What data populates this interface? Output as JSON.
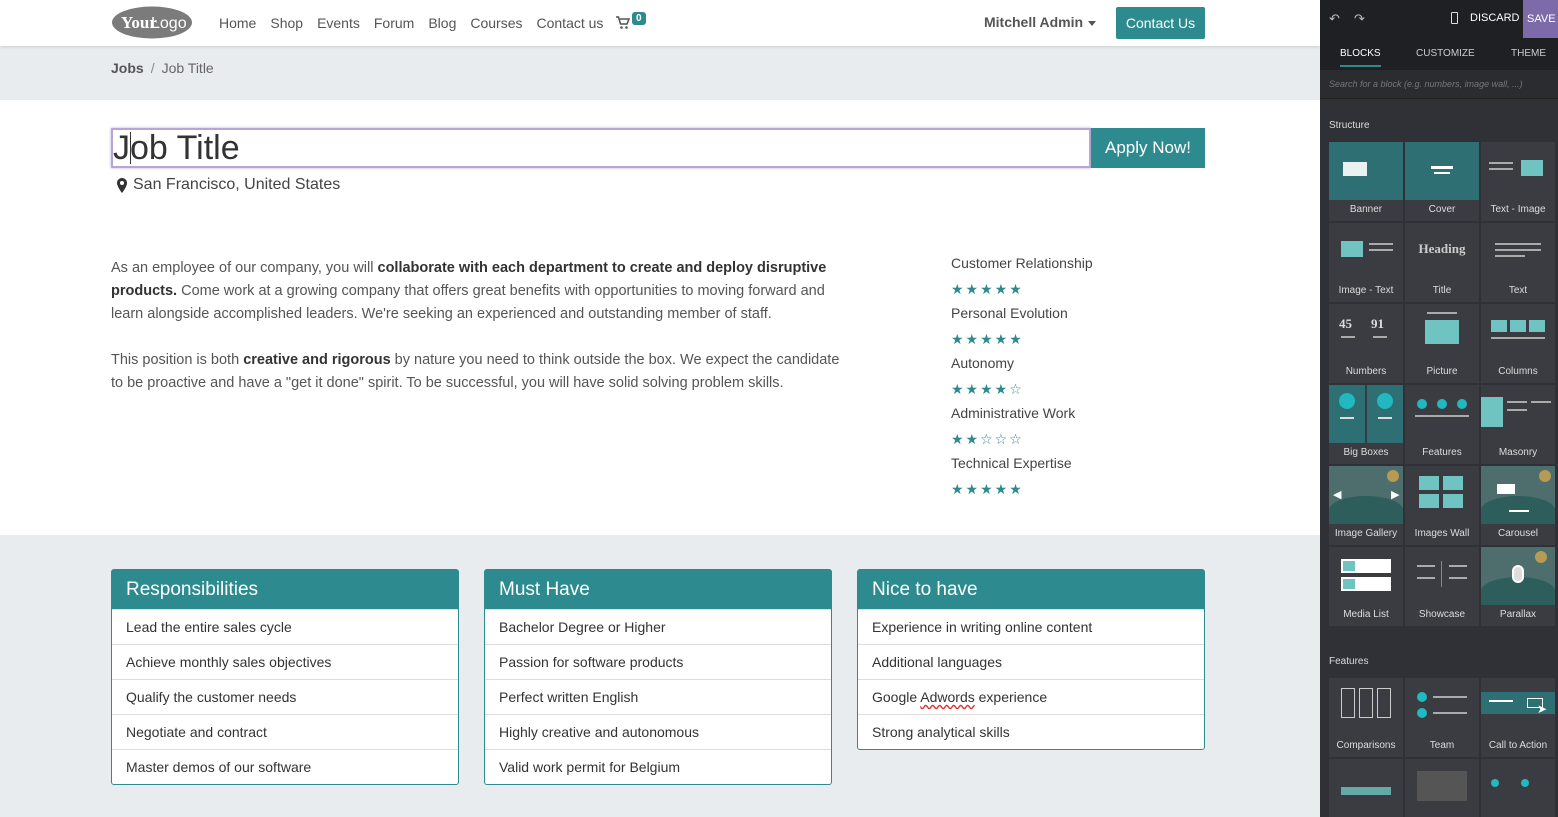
{
  "nav": {
    "logo_text_1": "Your",
    "logo_text_2": "Logo",
    "links": [
      "Home",
      "Shop",
      "Events",
      "Forum",
      "Blog",
      "Courses",
      "Contact us"
    ],
    "cart_count": "0",
    "user": "Mitchell Admin",
    "contact_button": "Contact Us"
  },
  "breadcrumb": {
    "parent": "Jobs",
    "separator": "/",
    "current": "Job Title"
  },
  "job": {
    "title": "Job Title",
    "apply_button": "Apply Now!",
    "location": "San Francisco, United States"
  },
  "description": {
    "p1_a": "As an employee of our company, you will ",
    "p1_b": "collaborate with each department to create and deploy disruptive products.",
    "p1_c": " Come work at a growing company that offers great benefits with opportunities to moving forward and learn alongside accomplished leaders. We're seeking an experienced and outstanding member of staff.",
    "p2_a": "This position is both ",
    "p2_b": "creative and rigorous",
    "p2_c": " by nature you need to think outside the box. We expect the candidate to be proactive and have a \"get it done\" spirit. To be successful, you will have solid solving problem skills."
  },
  "skills": [
    {
      "name": "Customer Relationship",
      "stars": "★★★★★",
      "rating": 5
    },
    {
      "name": "Personal Evolution",
      "stars": "★★★★★",
      "rating": 5
    },
    {
      "name": "Autonomy",
      "stars": "★★★★☆",
      "rating": 4
    },
    {
      "name": "Administrative Work",
      "stars": "★★☆☆☆",
      "rating": 2
    },
    {
      "name": "Technical Expertise",
      "stars": "★★★★★",
      "rating": 5
    }
  ],
  "panels": [
    {
      "title": "Responsibilities",
      "items": [
        "Lead the entire sales cycle",
        "Achieve monthly sales objectives",
        "Qualify the customer needs",
        "Negotiate and contract",
        "Master demos of our software"
      ]
    },
    {
      "title": "Must Have",
      "items": [
        "Bachelor Degree or Higher",
        "Passion for software products",
        "Perfect written English",
        "Highly creative and autonomous",
        "Valid work permit for Belgium"
      ]
    },
    {
      "title": "Nice to have",
      "items": [
        "Experience in writing online content",
        "Additional languages",
        "Google Adwords experience",
        "Strong analytical skills"
      ]
    }
  ],
  "editor": {
    "discard": "DISCARD",
    "save": "SAVE",
    "tabs": [
      "BLOCKS",
      "CUSTOMIZE",
      "THEME"
    ],
    "search_placeholder": "Search for a block (e.g. numbers, image wall, ...)",
    "section_structure": "Structure",
    "section_features": "Features",
    "structure_blocks": [
      "Banner",
      "Cover",
      "Text - Image",
      "Image - Text",
      "Title",
      "Text",
      "Numbers",
      "Picture",
      "Columns",
      "Big Boxes",
      "Features",
      "Masonry",
      "Image Gallery",
      "Images Wall",
      "Carousel",
      "Media List",
      "Showcase",
      "Parallax"
    ],
    "feature_blocks": [
      "Comparisons",
      "Team",
      "Call to Action"
    ],
    "thumb_heading": "Heading",
    "thumb_num_1": "45",
    "thumb_num_2": "91"
  },
  "colors": {
    "accent": "#2d8b8f",
    "save": "#7c6ba8",
    "editor_bg": "#2f3136"
  }
}
